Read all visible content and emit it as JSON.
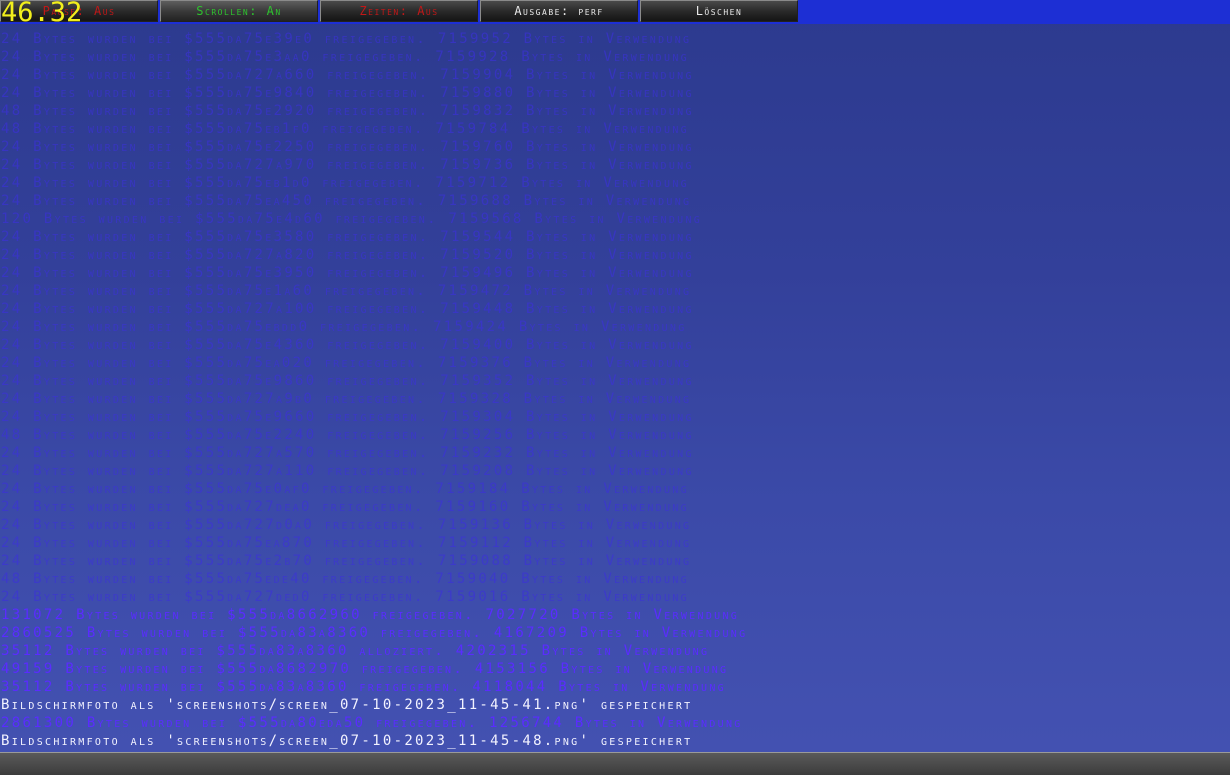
{
  "fps_counter": "46.32",
  "toolbar": {
    "buttons": [
      {
        "label": "Pause: Aus",
        "color": "#c01818"
      },
      {
        "label": "Scrollen: An",
        "color": "#2ec32e"
      },
      {
        "label": "Zeiten: Aus",
        "color": "#c01818"
      },
      {
        "label": "Ausgabe: perf",
        "color": "#e8e8e8"
      },
      {
        "label": "Löschen",
        "color": "#e8e8e8"
      }
    ]
  },
  "log": {
    "lines": [
      {
        "text": "24 Bytes wurden bei $555da75e39e0 freigegeben. 7159952 Bytes in Verwendung",
        "style": "faint"
      },
      {
        "text": "24 Bytes wurden bei $555da75e3aa0 freigegeben. 7159928 Bytes in Verwendung",
        "style": "faint"
      },
      {
        "text": "24 Bytes wurden bei $555da727a660 freigegeben. 7159904 Bytes in Verwendung",
        "style": "faint"
      },
      {
        "text": "24 Bytes wurden bei $555da75e9840 freigegeben. 7159880 Bytes in Verwendung",
        "style": "faint"
      },
      {
        "text": "48 Bytes wurden bei $555da75e2920 freigegeben. 7159832 Bytes in Verwendung",
        "style": "faint"
      },
      {
        "text": "48 Bytes wurden bei $555da75eb1f0 freigegeben. 7159784 Bytes in Verwendung",
        "style": "faint"
      },
      {
        "text": "24 Bytes wurden bei $555da75e2250 freigegeben. 7159760 Bytes in Verwendung",
        "style": "faint"
      },
      {
        "text": "24 Bytes wurden bei $555da727a970 freigegeben. 7159736 Bytes in Verwendung",
        "style": "faint"
      },
      {
        "text": "24 Bytes wurden bei $555da75eb1d0 freigegeben. 7159712 Bytes in Verwendung",
        "style": "faint"
      },
      {
        "text": "24 Bytes wurden bei $555da75ea450 freigegeben. 7159688 Bytes in Verwendung",
        "style": "faint"
      },
      {
        "text": "120 Bytes wurden bei $555da75e4d60 freigegeben. 7159568 Bytes in Verwendung",
        "style": "faint"
      },
      {
        "text": "24 Bytes wurden bei $555da75e3580 freigegeben. 7159544 Bytes in Verwendung",
        "style": "faint"
      },
      {
        "text": "24 Bytes wurden bei $555da727a820 freigegeben. 7159520 Bytes in Verwendung",
        "style": "faint"
      },
      {
        "text": "24 Bytes wurden bei $555da75e3950 freigegeben. 7159496 Bytes in Verwendung",
        "style": "faint"
      },
      {
        "text": "24 Bytes wurden bei $555da75e1a60 freigegeben. 7159472 Bytes in Verwendung",
        "style": "faint"
      },
      {
        "text": "24 Bytes wurden bei $555da727a100 freigegeben. 7159448 Bytes in Verwendung",
        "style": "faint"
      },
      {
        "text": "24 Bytes wurden bei $555da75ebdd0 freigegeben. 7159424 Bytes in Verwendung",
        "style": "faint"
      },
      {
        "text": "24 Bytes wurden bei $555da75e4360 freigegeben. 7159400 Bytes in Verwendung",
        "style": "faint"
      },
      {
        "text": "24 Bytes wurden bei $555da75ea020 freigegeben. 7159376 Bytes in Verwendung",
        "style": "faint"
      },
      {
        "text": "24 Bytes wurden bei $555da75e9860 freigegeben. 7159352 Bytes in Verwendung",
        "style": "faint"
      },
      {
        "text": "24 Bytes wurden bei $555da727a9b0 freigegeben. 7159328 Bytes in Verwendung",
        "style": "faint"
      },
      {
        "text": "24 Bytes wurden bei $555da75e9660 freigegeben. 7159304 Bytes in Verwendung",
        "style": "faint"
      },
      {
        "text": "48 Bytes wurden bei $555da75e2240 freigegeben. 7159256 Bytes in Verwendung",
        "style": "faint"
      },
      {
        "text": "24 Bytes wurden bei $555da727a570 freigegeben. 7159232 Bytes in Verwendung",
        "style": "faint"
      },
      {
        "text": "24 Bytes wurden bei $555da727a110 freigegeben. 7159208 Bytes in Verwendung",
        "style": "faint"
      },
      {
        "text": "24 Bytes wurden bei $555da75e0af0 freigegeben. 7159184 Bytes in Verwendung",
        "style": "faint"
      },
      {
        "text": "24 Bytes wurden bei $555da727dea0 freigegeben. 7159160 Bytes in Verwendung",
        "style": "faint"
      },
      {
        "text": "24 Bytes wurden bei $555da727d0a0 freigegeben. 7159136 Bytes in Verwendung",
        "style": "faint"
      },
      {
        "text": "24 Bytes wurden bei $555da75ea870 freigegeben. 7159112 Bytes in Verwendung",
        "style": "faint"
      },
      {
        "text": "24 Bytes wurden bei $555da75e2b70 freigegeben. 7159088 Bytes in Verwendung",
        "style": "faint"
      },
      {
        "text": "48 Bytes wurden bei $555da75ede40 freigegeben. 7159040 Bytes in Verwendung",
        "style": "faint"
      },
      {
        "text": "24 Bytes wurden bei $555da727ded0 freigegeben. 7159016 Bytes in Verwendung",
        "style": "faint"
      },
      {
        "text": "131072 Bytes wurden bei $555da8662960 freigegeben. 7027720 Bytes in Verwendung",
        "style": "violet"
      },
      {
        "text": "2860525 Bytes wurden bei $555da83a8360 freigegeben. 4167209 Bytes in Verwendung",
        "style": "violet"
      },
      {
        "text": "35112 Bytes wurden bei $555da83a8360 alloziert. 4202315 Bytes in Verwendung",
        "style": "violet"
      },
      {
        "text": "49159 Bytes wurden bei $555da8682970 freigegeben. 4153156 Bytes in Verwendung",
        "style": "violet"
      },
      {
        "text": "35112 Bytes wurden bei $555da83a8360 freigegeben. 4118044 Bytes in Verwendung",
        "style": "violet"
      },
      {
        "text": "Bildschirmfoto als 'screenshots/screen_07-10-2023_11-45-41.png' gespeichert",
        "style": "white"
      },
      {
        "text": "2861300 Bytes wurden bei $555da80eda50 freigegeben. 1256744 Bytes in Verwendung",
        "style": "violet"
      },
      {
        "text": "Bildschirmfoto als 'screenshots/screen_07-10-2023_11-45-48.png' gespeichert",
        "style": "white"
      }
    ]
  },
  "colors": {
    "toolbar_background": "#1d2fd4",
    "fps_text": "#f2ef1c",
    "log_text_default": "#4a2bf2",
    "log_text_highlight": "#f2f2ff"
  }
}
